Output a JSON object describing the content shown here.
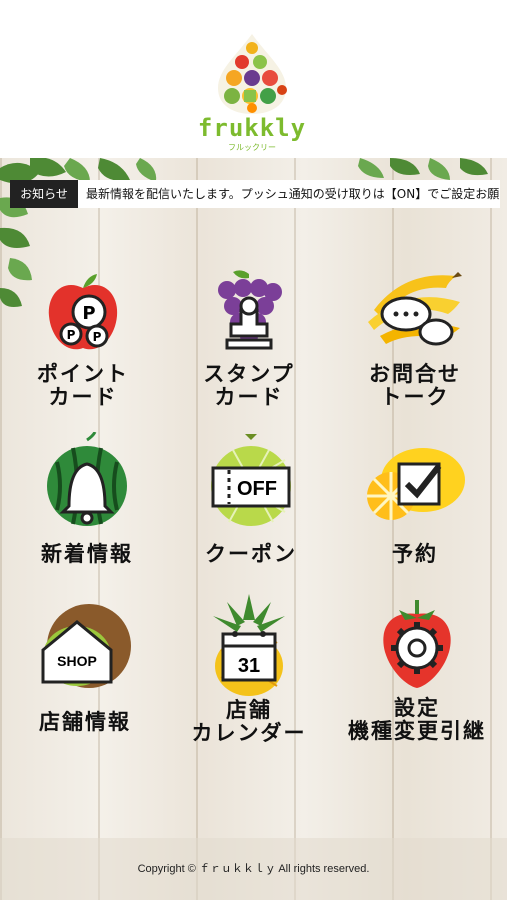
{
  "brand": {
    "name": "frukkly",
    "sub": "フルックリー"
  },
  "news": {
    "label": "お知らせ",
    "text": "最新情報を配信いたします。プッシュ通知の受け取りは【ON】でご設定お願"
  },
  "menu": [
    {
      "label": "ポイント\nカード",
      "icon": "apple-points-icon"
    },
    {
      "label": "スタンプ\nカード",
      "icon": "grape-stamp-icon"
    },
    {
      "label": "お問合せ\nトーク",
      "icon": "banana-chat-icon"
    },
    {
      "label": "新着情報",
      "icon": "watermelon-bell-icon"
    },
    {
      "label": "クーポン",
      "icon": "melon-coupon-icon",
      "badge": "OFF"
    },
    {
      "label": "予約",
      "icon": "lemon-check-icon"
    },
    {
      "label": "店舗情報",
      "icon": "kiwi-shop-icon",
      "badge": "SHOP"
    },
    {
      "label": "店舗\nカレンダー",
      "icon": "pineapple-calendar-icon",
      "badge": "31"
    },
    {
      "label": "設定\n機種変更引継",
      "icon": "strawberry-gear-icon"
    }
  ],
  "footer": {
    "copyright": "Copyright © ｆｒｕｋｋｌｙ All rights reserved."
  }
}
